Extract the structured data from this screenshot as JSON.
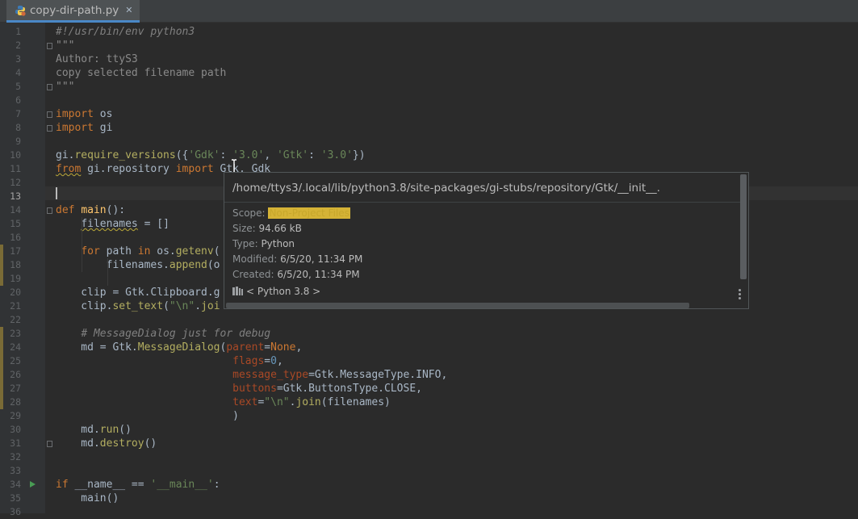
{
  "tab": {
    "filename": "copy-dir-path.py",
    "close_glyph": "✕",
    "icon": "python-file-icon"
  },
  "line_numbers": [
    "1",
    "2",
    "3",
    "4",
    "5",
    "6",
    "7",
    "8",
    "9",
    "10",
    "11",
    "12",
    "13",
    "14",
    "15",
    "16",
    "17",
    "18",
    "19",
    "20",
    "21",
    "22",
    "23",
    "24",
    "25",
    "26",
    "27",
    "28",
    "29",
    "30",
    "31",
    "32",
    "33",
    "34",
    "35",
    "36"
  ],
  "current_line": 13,
  "code_lines": [
    [
      {
        "t": "#!/usr/bin/env python3",
        "c": "cmt"
      }
    ],
    [
      {
        "t": "\"\"\"",
        "c": "doc"
      }
    ],
    [
      {
        "t": "Author: ttyS3",
        "c": "doc"
      }
    ],
    [
      {
        "t": "copy selected filename path",
        "c": "doc"
      }
    ],
    [
      {
        "t": "\"\"\"",
        "c": "doc"
      }
    ],
    [],
    [
      {
        "t": "import",
        "c": "kw"
      },
      {
        "t": " os"
      }
    ],
    [
      {
        "t": "import",
        "c": "kw"
      },
      {
        "t": " gi"
      }
    ],
    [],
    [
      {
        "t": "gi."
      },
      {
        "t": "require_versions",
        "c": "meth"
      },
      {
        "t": "({"
      },
      {
        "t": "'Gdk'",
        "c": "str"
      },
      {
        "t": ": "
      },
      {
        "t": "'3.0'",
        "c": "str"
      },
      {
        "t": ", "
      },
      {
        "t": "'Gtk'",
        "c": "str"
      },
      {
        "t": ": "
      },
      {
        "t": "'3.0'",
        "c": "str"
      },
      {
        "t": "})"
      }
    ],
    [
      {
        "t": "from",
        "c": "kw squig"
      },
      {
        "t": " gi.repository "
      },
      {
        "t": "import",
        "c": "kw"
      },
      {
        "t": " Gtk, Gdk"
      }
    ],
    [],
    [],
    [
      {
        "t": "def",
        "c": "kw"
      },
      {
        "t": " "
      },
      {
        "t": "main",
        "c": "fn"
      },
      {
        "t": "():"
      }
    ],
    [
      {
        "t": "    "
      },
      {
        "t": "filenames",
        "c": "squig"
      },
      {
        "t": " = []"
      }
    ],
    [],
    [
      {
        "t": "    "
      },
      {
        "t": "for",
        "c": "kw"
      },
      {
        "t": " path "
      },
      {
        "t": "in",
        "c": "kw"
      },
      {
        "t": " os."
      },
      {
        "t": "getenv",
        "c": "meth"
      },
      {
        "t": "("
      }
    ],
    [
      {
        "t": "        filenames."
      },
      {
        "t": "append",
        "c": "meth"
      },
      {
        "t": "(o"
      }
    ],
    [],
    [
      {
        "t": "    clip = Gtk.Clipboard.g"
      }
    ],
    [
      {
        "t": "    clip."
      },
      {
        "t": "set_text",
        "c": "meth"
      },
      {
        "t": "("
      },
      {
        "t": "\"\\n\"",
        "c": "str"
      },
      {
        "t": "."
      },
      {
        "t": "joi",
        "c": "meth"
      }
    ],
    [],
    [
      {
        "t": "    "
      },
      {
        "t": "# MessageDialog just for debug",
        "c": "cmt"
      }
    ],
    [
      {
        "t": "    md = Gtk."
      },
      {
        "t": "MessageDialog",
        "c": "meth"
      },
      {
        "t": "("
      },
      {
        "t": "parent",
        "c": "prm"
      },
      {
        "t": "="
      },
      {
        "t": "None",
        "c": "kw"
      },
      {
        "t": ","
      }
    ],
    [
      {
        "t": "                            "
      },
      {
        "t": "flags",
        "c": "prm"
      },
      {
        "t": "="
      },
      {
        "t": "0",
        "c": "num"
      },
      {
        "t": ","
      }
    ],
    [
      {
        "t": "                            "
      },
      {
        "t": "message_type",
        "c": "prm"
      },
      {
        "t": "=Gtk.MessageType.INFO,"
      }
    ],
    [
      {
        "t": "                            "
      },
      {
        "t": "buttons",
        "c": "prm"
      },
      {
        "t": "=Gtk.ButtonsType.CLOSE,"
      }
    ],
    [
      {
        "t": "                            "
      },
      {
        "t": "text",
        "c": "prm"
      },
      {
        "t": "="
      },
      {
        "t": "\"\\n\"",
        "c": "str"
      },
      {
        "t": "."
      },
      {
        "t": "join",
        "c": "meth"
      },
      {
        "t": "(filenames)"
      }
    ],
    [
      {
        "t": "                            )"
      }
    ],
    [
      {
        "t": "    md."
      },
      {
        "t": "run",
        "c": "meth"
      },
      {
        "t": "()"
      }
    ],
    [
      {
        "t": "    md."
      },
      {
        "t": "destroy",
        "c": "meth"
      },
      {
        "t": "()"
      }
    ],
    [],
    [],
    [
      {
        "t": "if",
        "c": "kw"
      },
      {
        "t": " __name__ == "
      },
      {
        "t": "'__main__'",
        "c": "str"
      },
      {
        "t": ":"
      }
    ],
    [
      {
        "t": "    main()"
      }
    ],
    []
  ],
  "popup": {
    "path": "/home/ttys3/.local/lib/python3.8/site-packages/gi-stubs/repository/Gtk/__init__.",
    "scope_label": "Scope:",
    "scope_value": "Non-Project Files",
    "size_label": "Size:",
    "size_value": "94.66 kB",
    "type_label": "Type:",
    "type_value": "Python",
    "modified_label": "Modified:",
    "modified_value": "6/5/20, 11:34 PM",
    "created_label": "Created:",
    "created_value": "6/5/20, 11:34 PM",
    "library_text": "< Python 3.8 >",
    "library_icon": "library-icon",
    "more_icon": "more-vertical-icon"
  },
  "colors": {
    "background": "#2b2b2b",
    "gutter": "#313335",
    "keyword": "#cc7832",
    "string": "#6a8759",
    "function": "#ffc66d",
    "highlight": "#d5b336"
  }
}
